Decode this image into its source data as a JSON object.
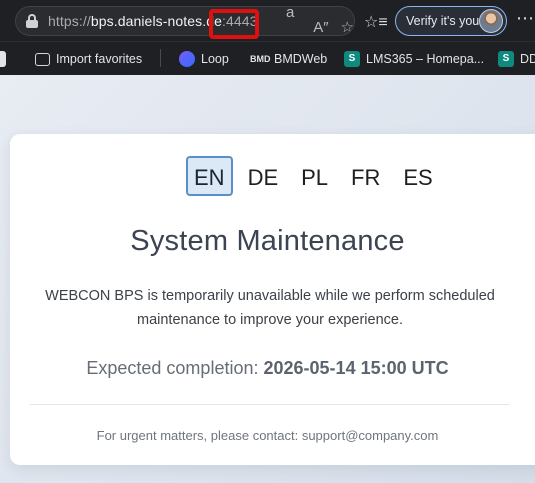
{
  "browser": {
    "url_scheme": "https://",
    "url_host": "bps.daniels-notes.d",
    "url_host_tail": "e",
    "url_port": ":4443",
    "verify_label": "Verify it's you",
    "icons": {
      "lock": "lock-icon",
      "translate": "translate-icon",
      "read_aloud": "read-aloud-icon",
      "favorite": "star-icon",
      "favorites_list": "favorites-list-icon",
      "more": "more-icon"
    },
    "favorites_bar": [
      {
        "label": "Import favorites",
        "icon": "import-favorites-icon"
      },
      {
        "label": "Loop",
        "icon": "loop-icon"
      },
      {
        "label": "BMDWeb",
        "icon": "bmdweb-icon"
      },
      {
        "label": "LMS365 – Homepa...",
        "icon": "sharepoint-icon"
      },
      {
        "label": "DD",
        "icon": "sharepoint-icon"
      }
    ],
    "highlight_color": "#e01010"
  },
  "maintenance": {
    "languages": [
      "EN",
      "DE",
      "PL",
      "FR",
      "ES"
    ],
    "active_language": "EN",
    "title": "System Maintenance",
    "description": "WEBCON BPS is temporarily unavailable while we perform scheduled maintenance to improve your experience.",
    "eta_label": "Expected completion:",
    "eta_value": "2026-05-14 15:00 UTC",
    "contact": "For urgent matters, please contact: support@company.com",
    "accent_color": "#5b8fc7"
  }
}
